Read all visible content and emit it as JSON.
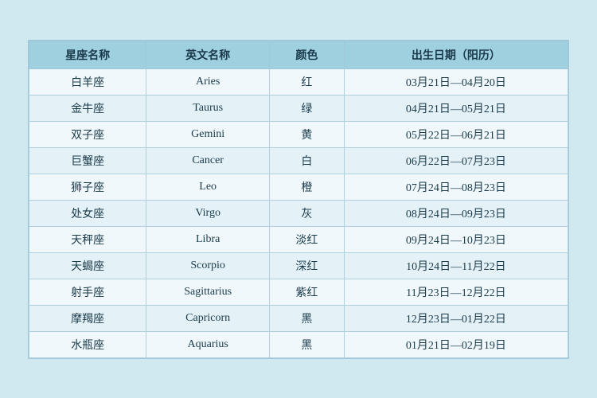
{
  "table": {
    "headers": [
      "星座名称",
      "英文名称",
      "颜色",
      "出生日期（阳历）"
    ],
    "rows": [
      {
        "zh": "白羊座",
        "en": "Aries",
        "color": "红",
        "dates": "03月21日—04月20日"
      },
      {
        "zh": "金牛座",
        "en": "Taurus",
        "color": "绿",
        "dates": "04月21日—05月21日"
      },
      {
        "zh": "双子座",
        "en": "Gemini",
        "color": "黄",
        "dates": "05月22日—06月21日"
      },
      {
        "zh": "巨蟹座",
        "en": "Cancer",
        "color": "白",
        "dates": "06月22日—07月23日"
      },
      {
        "zh": "狮子座",
        "en": "Leo",
        "color": "橙",
        "dates": "07月24日—08月23日"
      },
      {
        "zh": "处女座",
        "en": "Virgo",
        "color": "灰",
        "dates": "08月24日—09月23日"
      },
      {
        "zh": "天秤座",
        "en": "Libra",
        "color": "淡红",
        "dates": "09月24日—10月23日"
      },
      {
        "zh": "天蝎座",
        "en": "Scorpio",
        "color": "深红",
        "dates": "10月24日—11月22日"
      },
      {
        "zh": "射手座",
        "en": "Sagittarius",
        "color": "紫红",
        "dates": "11月23日—12月22日"
      },
      {
        "zh": "摩羯座",
        "en": "Capricorn",
        "color": "黑",
        "dates": "12月23日—01月22日"
      },
      {
        "zh": "水瓶座",
        "en": "Aquarius",
        "color": "黑",
        "dates": "01月21日—02月19日"
      }
    ]
  }
}
